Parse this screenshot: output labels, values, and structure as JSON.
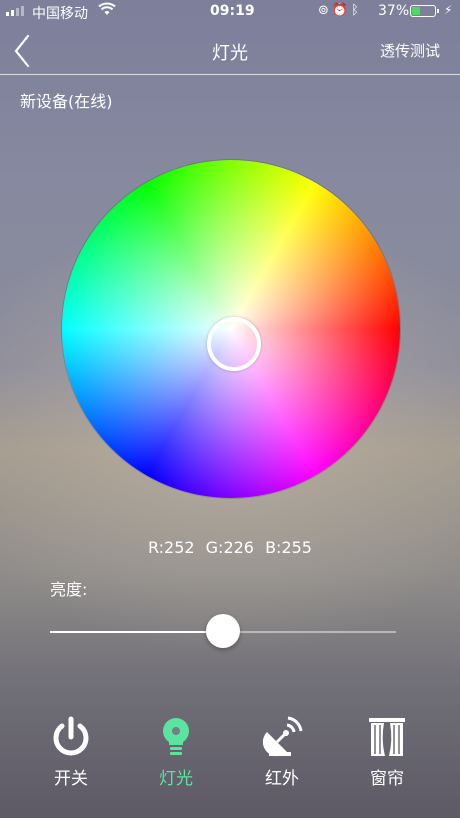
{
  "status_bar": {
    "carrier": "中国移动",
    "time": "09:19",
    "battery_percent": "37%",
    "battery_level": 0.37,
    "icons": [
      "signal-icon",
      "wifi-icon",
      "orientation-lock-icon",
      "alarm-icon",
      "bluetooth-icon",
      "battery-icon",
      "charging-icon"
    ]
  },
  "nav": {
    "back_icon": "chevron-left-icon",
    "title": "灯光",
    "right_action": "透传测试"
  },
  "device": {
    "name": "新设备(在线)"
  },
  "color": {
    "r_label": "R:252",
    "g_label": "G:226",
    "b_label": "B:255",
    "readout": "R:252  G:226  B:255",
    "selected_hex": "#fce2ff"
  },
  "brightness": {
    "label": "亮度:",
    "value": 0.5
  },
  "tabs": [
    {
      "label": "开关",
      "icon": "power-icon",
      "active": false
    },
    {
      "label": "灯光",
      "icon": "bulb-icon",
      "active": true
    },
    {
      "label": "红外",
      "icon": "satellite-dish-icon",
      "active": false
    },
    {
      "label": "窗帘",
      "icon": "curtain-icon",
      "active": false
    }
  ],
  "colors": {
    "accent": "#5be3a0",
    "battery_fill": "#4cd964"
  }
}
